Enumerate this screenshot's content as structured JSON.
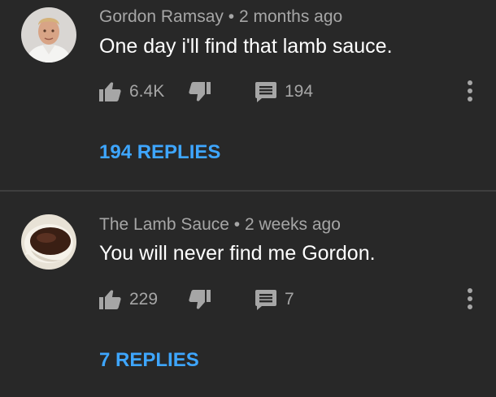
{
  "colors": {
    "background": "#282828",
    "link": "#3ea6ff",
    "text": "#ffffff",
    "meta": "#a6a6a6"
  },
  "comments": [
    {
      "author": "Gordon Ramsay",
      "separator": "•",
      "time": "2 months ago",
      "text": "One day i'll find that lamb sauce.",
      "likes": "6.4K",
      "reply_count": "194",
      "replies_link": "194 REPLIES",
      "avatar_icon": "chef-portrait-avatar"
    },
    {
      "author": "The Lamb Sauce",
      "separator": "•",
      "time": "2 weeks ago",
      "text": "You will never find me Gordon.",
      "likes": "229",
      "reply_count": "7",
      "replies_link": "7 REPLIES",
      "avatar_icon": "sauce-boat-avatar"
    }
  ],
  "icons": {
    "like": "thumbs-up-icon",
    "dislike": "thumbs-down-icon",
    "reply": "comment-icon",
    "more": "more-vertical-icon"
  }
}
